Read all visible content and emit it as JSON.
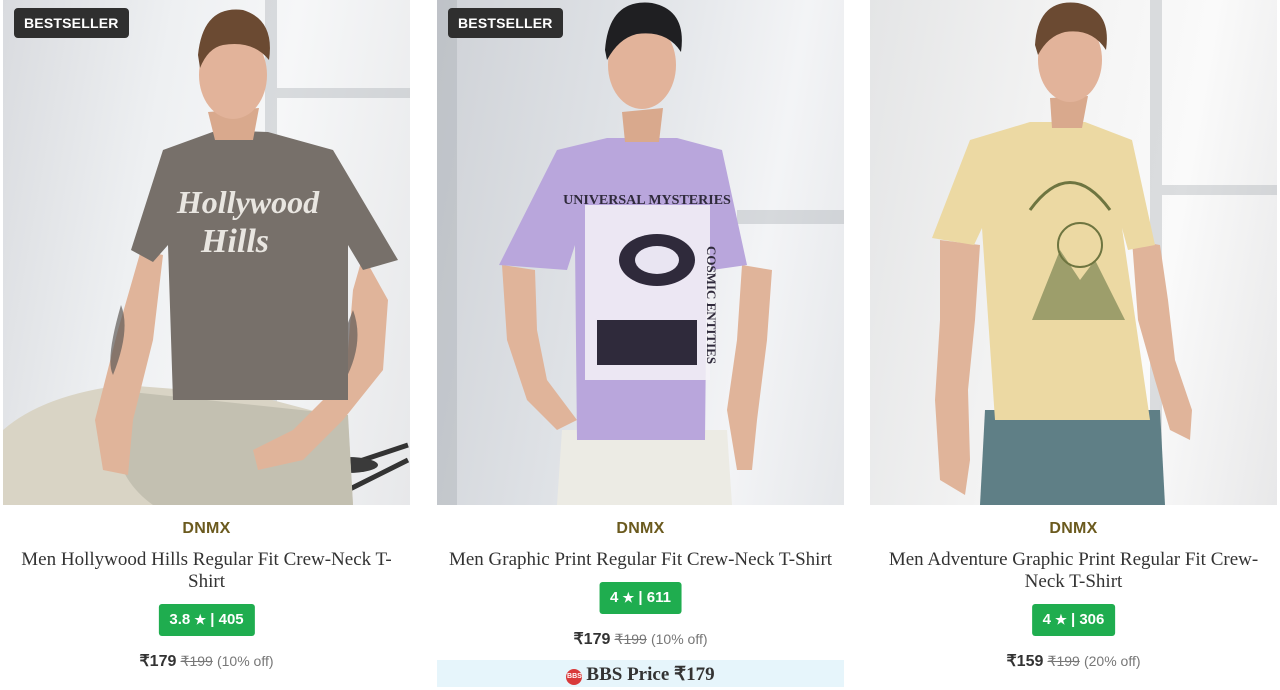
{
  "products": [
    {
      "badge": "BESTSELLER",
      "brand": "DNMX",
      "title": "Men Hollywood Hills Regular Fit Crew-Neck T-Shirt",
      "rating": "3.8",
      "rating_star": "★",
      "rating_sep": "|",
      "reviews": "405",
      "price": "₹179",
      "mrp": "₹199",
      "discount": "(10% off)",
      "shirt_color": "#77706a",
      "shirt_print": "Hollywood Hills"
    },
    {
      "badge": "BESTSELLER",
      "brand": "DNMX",
      "title": "Men Graphic Print Regular Fit Crew-Neck T-Shirt",
      "rating": "4",
      "rating_star": "★",
      "rating_sep": "|",
      "reviews": "611",
      "price": "₹179",
      "mrp": "₹199",
      "discount": "(10% off)",
      "bbs_icon": "BBS",
      "bbs_price": "BBS Price ₹179",
      "shirt_color": "#b9a6dc"
    },
    {
      "brand": "DNMX",
      "title": "Men Adventure Graphic Print Regular Fit Crew-Neck T-Shirt",
      "rating": "4",
      "rating_star": "★",
      "rating_sep": "|",
      "reviews": "306",
      "price": "₹159",
      "mrp": "₹199",
      "discount": "(20% off)",
      "shirt_color": "#ecd9a3"
    }
  ],
  "colors": {
    "badge_bg": "#2f2f2f",
    "brand_text": "#6b5a1e",
    "rating_bg": "#1fad4f",
    "bbs_bg": "#e6f5fb"
  }
}
